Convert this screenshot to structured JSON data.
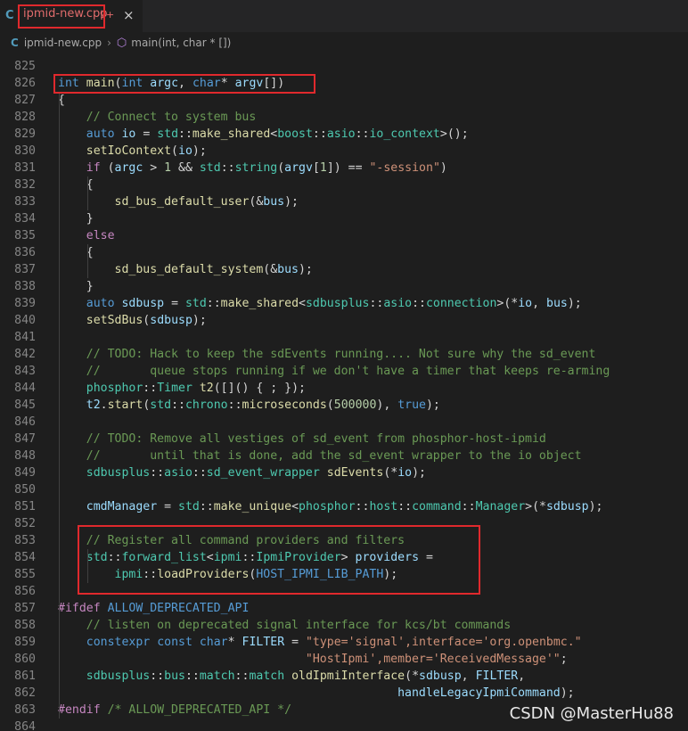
{
  "tab": {
    "icon": "C",
    "filename": "ipmid-new.cpp",
    "badge": "9+",
    "close": "×"
  },
  "breadcrumb": {
    "file": "ipmid-new.cpp",
    "separator": "›",
    "symbol": "main(int, char * [])"
  },
  "watermark": "CSDN @MasterHu88",
  "accent_colors": {
    "highlight_box": "#e0292d",
    "keyword": "#569cd6",
    "type": "#4ec9b0",
    "function": "#dcdcaa",
    "string": "#ce9178",
    "comment": "#6a9955"
  },
  "code": [
    {
      "n": "825",
      "t": []
    },
    {
      "n": "826",
      "t": [
        [
          "kw",
          "int"
        ],
        [
          "pun",
          " "
        ],
        [
          "fn",
          "main"
        ],
        [
          "pun",
          "("
        ],
        [
          "kw",
          "int"
        ],
        [
          "pun",
          " "
        ],
        [
          "var",
          "argc"
        ],
        [
          "pun",
          ", "
        ],
        [
          "kw",
          "char"
        ],
        [
          "pun",
          "* "
        ],
        [
          "var",
          "argv"
        ],
        [
          "pun",
          "[])"
        ]
      ]
    },
    {
      "n": "827",
      "t": [
        [
          "pun",
          "{"
        ]
      ]
    },
    {
      "n": "828",
      "t": [
        [
          "pun",
          "    "
        ],
        [
          "cm",
          "// Connect to system bus"
        ]
      ]
    },
    {
      "n": "829",
      "t": [
        [
          "pun",
          "    "
        ],
        [
          "kw",
          "auto"
        ],
        [
          "pun",
          " "
        ],
        [
          "var",
          "io"
        ],
        [
          "pun",
          " = "
        ],
        [
          "ty",
          "std"
        ],
        [
          "pun",
          "::"
        ],
        [
          "fn",
          "make_shared"
        ],
        [
          "pun",
          "<"
        ],
        [
          "ty",
          "boost"
        ],
        [
          "pun",
          "::"
        ],
        [
          "ty",
          "asio"
        ],
        [
          "pun",
          "::"
        ],
        [
          "ty",
          "io_context"
        ],
        [
          "pun",
          ">();"
        ]
      ]
    },
    {
      "n": "830",
      "t": [
        [
          "pun",
          "    "
        ],
        [
          "fn",
          "setIoContext"
        ],
        [
          "pun",
          "("
        ],
        [
          "var",
          "io"
        ],
        [
          "pun",
          ");"
        ]
      ]
    },
    {
      "n": "831",
      "t": [
        [
          "pun",
          "    "
        ],
        [
          "ctl",
          "if"
        ],
        [
          "pun",
          " ("
        ],
        [
          "var",
          "argc"
        ],
        [
          "pun",
          " > "
        ],
        [
          "num",
          "1"
        ],
        [
          "pun",
          " && "
        ],
        [
          "ty",
          "std"
        ],
        [
          "pun",
          "::"
        ],
        [
          "ty",
          "string"
        ],
        [
          "pun",
          "("
        ],
        [
          "var",
          "argv"
        ],
        [
          "pun",
          "["
        ],
        [
          "num",
          "1"
        ],
        [
          "pun",
          "]) == "
        ],
        [
          "str",
          "\"-session\""
        ],
        [
          "pun",
          ")"
        ]
      ]
    },
    {
      "n": "832",
      "t": [
        [
          "pun",
          "    {"
        ]
      ]
    },
    {
      "n": "833",
      "t": [
        [
          "pun",
          "        "
        ],
        [
          "fn",
          "sd_bus_default_user"
        ],
        [
          "pun",
          "(&"
        ],
        [
          "var",
          "bus"
        ],
        [
          "pun",
          ");"
        ]
      ]
    },
    {
      "n": "834",
      "t": [
        [
          "pun",
          "    }"
        ]
      ]
    },
    {
      "n": "835",
      "t": [
        [
          "pun",
          "    "
        ],
        [
          "ctl",
          "else"
        ]
      ]
    },
    {
      "n": "836",
      "t": [
        [
          "pun",
          "    {"
        ]
      ]
    },
    {
      "n": "837",
      "t": [
        [
          "pun",
          "        "
        ],
        [
          "fn",
          "sd_bus_default_system"
        ],
        [
          "pun",
          "(&"
        ],
        [
          "var",
          "bus"
        ],
        [
          "pun",
          ");"
        ]
      ]
    },
    {
      "n": "838",
      "t": [
        [
          "pun",
          "    }"
        ]
      ]
    },
    {
      "n": "839",
      "t": [
        [
          "pun",
          "    "
        ],
        [
          "kw",
          "auto"
        ],
        [
          "pun",
          " "
        ],
        [
          "var",
          "sdbusp"
        ],
        [
          "pun",
          " = "
        ],
        [
          "ty",
          "std"
        ],
        [
          "pun",
          "::"
        ],
        [
          "fn",
          "make_shared"
        ],
        [
          "pun",
          "<"
        ],
        [
          "ty",
          "sdbusplus"
        ],
        [
          "pun",
          "::"
        ],
        [
          "ty",
          "asio"
        ],
        [
          "pun",
          "::"
        ],
        [
          "ty",
          "connection"
        ],
        [
          "pun",
          ">(*"
        ],
        [
          "var",
          "io"
        ],
        [
          "pun",
          ", "
        ],
        [
          "var",
          "bus"
        ],
        [
          "pun",
          ");"
        ]
      ]
    },
    {
      "n": "840",
      "t": [
        [
          "pun",
          "    "
        ],
        [
          "fn",
          "setSdBus"
        ],
        [
          "pun",
          "("
        ],
        [
          "var",
          "sdbusp"
        ],
        [
          "pun",
          ");"
        ]
      ]
    },
    {
      "n": "841",
      "t": []
    },
    {
      "n": "842",
      "t": [
        [
          "pun",
          "    "
        ],
        [
          "cm",
          "// TODO: Hack to keep the sdEvents running.... Not sure why the sd_event"
        ]
      ]
    },
    {
      "n": "843",
      "t": [
        [
          "pun",
          "    "
        ],
        [
          "cm",
          "//       queue stops running if we don't have a timer that keeps re-arming"
        ]
      ]
    },
    {
      "n": "844",
      "t": [
        [
          "pun",
          "    "
        ],
        [
          "ty",
          "phosphor"
        ],
        [
          "pun",
          "::"
        ],
        [
          "ty",
          "Timer"
        ],
        [
          "pun",
          " "
        ],
        [
          "fn",
          "t2"
        ],
        [
          "pun",
          "([]() { ; });"
        ]
      ]
    },
    {
      "n": "845",
      "t": [
        [
          "pun",
          "    "
        ],
        [
          "var",
          "t2"
        ],
        [
          "pun",
          "."
        ],
        [
          "fn",
          "start"
        ],
        [
          "pun",
          "("
        ],
        [
          "ty",
          "std"
        ],
        [
          "pun",
          "::"
        ],
        [
          "ty",
          "chrono"
        ],
        [
          "pun",
          "::"
        ],
        [
          "fn",
          "microseconds"
        ],
        [
          "pun",
          "("
        ],
        [
          "num",
          "500000"
        ],
        [
          "pun",
          "), "
        ],
        [
          "kw",
          "true"
        ],
        [
          "pun",
          ");"
        ]
      ]
    },
    {
      "n": "846",
      "t": []
    },
    {
      "n": "847",
      "t": [
        [
          "pun",
          "    "
        ],
        [
          "cm",
          "// TODO: Remove all vestiges of sd_event from phosphor-host-ipmid"
        ]
      ]
    },
    {
      "n": "848",
      "t": [
        [
          "pun",
          "    "
        ],
        [
          "cm",
          "//       until that is done, add the sd_event wrapper to the io object"
        ]
      ]
    },
    {
      "n": "849",
      "t": [
        [
          "pun",
          "    "
        ],
        [
          "ty",
          "sdbusplus"
        ],
        [
          "pun",
          "::"
        ],
        [
          "ty",
          "asio"
        ],
        [
          "pun",
          "::"
        ],
        [
          "ty",
          "sd_event_wrapper"
        ],
        [
          "pun",
          " "
        ],
        [
          "fn",
          "sdEvents"
        ],
        [
          "pun",
          "(*"
        ],
        [
          "var",
          "io"
        ],
        [
          "pun",
          ");"
        ]
      ]
    },
    {
      "n": "850",
      "t": []
    },
    {
      "n": "851",
      "t": [
        [
          "pun",
          "    "
        ],
        [
          "var",
          "cmdManager"
        ],
        [
          "pun",
          " = "
        ],
        [
          "ty",
          "std"
        ],
        [
          "pun",
          "::"
        ],
        [
          "fn",
          "make_unique"
        ],
        [
          "pun",
          "<"
        ],
        [
          "ty",
          "phosphor"
        ],
        [
          "pun",
          "::"
        ],
        [
          "ty",
          "host"
        ],
        [
          "pun",
          "::"
        ],
        [
          "ty",
          "command"
        ],
        [
          "pun",
          "::"
        ],
        [
          "ty",
          "Manager"
        ],
        [
          "pun",
          ">(*"
        ],
        [
          "var",
          "sdbusp"
        ],
        [
          "pun",
          ");"
        ]
      ]
    },
    {
      "n": "852",
      "t": []
    },
    {
      "n": "853",
      "t": [
        [
          "pun",
          "    "
        ],
        [
          "cm",
          "// Register all command providers and filters"
        ]
      ]
    },
    {
      "n": "854",
      "t": [
        [
          "pun",
          "    "
        ],
        [
          "ty",
          "std"
        ],
        [
          "pun",
          "::"
        ],
        [
          "ty",
          "forward_list"
        ],
        [
          "pun",
          "<"
        ],
        [
          "ty",
          "ipmi"
        ],
        [
          "pun",
          "::"
        ],
        [
          "ty",
          "IpmiProvider"
        ],
        [
          "pun",
          "> "
        ],
        [
          "var",
          "providers"
        ],
        [
          "pun",
          " ="
        ]
      ]
    },
    {
      "n": "855",
      "t": [
        [
          "pun",
          "        "
        ],
        [
          "ty",
          "ipmi"
        ],
        [
          "pun",
          "::"
        ],
        [
          "fn",
          "loadProviders"
        ],
        [
          "pun",
          "("
        ],
        [
          "mac",
          "HOST_IPMI_LIB_PATH"
        ],
        [
          "pun",
          ");"
        ]
      ]
    },
    {
      "n": "856",
      "t": []
    },
    {
      "n": "857",
      "t": [
        [
          "ctl",
          "#ifdef"
        ],
        [
          "pun",
          " "
        ],
        [
          "mac",
          "ALLOW_DEPRECATED_API"
        ]
      ]
    },
    {
      "n": "858",
      "t": [
        [
          "pun",
          "    "
        ],
        [
          "cm",
          "// listen on deprecated signal interface for kcs/bt commands"
        ]
      ]
    },
    {
      "n": "859",
      "t": [
        [
          "pun",
          "    "
        ],
        [
          "kw",
          "constexpr"
        ],
        [
          "pun",
          " "
        ],
        [
          "kw",
          "const"
        ],
        [
          "pun",
          " "
        ],
        [
          "kw",
          "char"
        ],
        [
          "pun",
          "* "
        ],
        [
          "var",
          "FILTER"
        ],
        [
          "pun",
          " = "
        ],
        [
          "str",
          "\"type='signal',interface='org.openbmc.\""
        ]
      ]
    },
    {
      "n": "860",
      "t": [
        [
          "pun",
          "                                   "
        ],
        [
          "str",
          "\"HostIpmi',member='ReceivedMessage'\""
        ],
        [
          "pun",
          ";"
        ]
      ]
    },
    {
      "n": "861",
      "t": [
        [
          "pun",
          "    "
        ],
        [
          "ty",
          "sdbusplus"
        ],
        [
          "pun",
          "::"
        ],
        [
          "ty",
          "bus"
        ],
        [
          "pun",
          "::"
        ],
        [
          "ty",
          "match"
        ],
        [
          "pun",
          "::"
        ],
        [
          "ty",
          "match"
        ],
        [
          "pun",
          " "
        ],
        [
          "fn",
          "oldIpmiInterface"
        ],
        [
          "pun",
          "(*"
        ],
        [
          "var",
          "sdbusp"
        ],
        [
          "pun",
          ", "
        ],
        [
          "var",
          "FILTER"
        ],
        [
          "pun",
          ","
        ]
      ]
    },
    {
      "n": "862",
      "t": [
        [
          "pun",
          "                                                "
        ],
        [
          "var",
          "handleLegacyIpmiCommand"
        ],
        [
          "pun",
          ");"
        ]
      ]
    },
    {
      "n": "863",
      "t": [
        [
          "ctl",
          "#endif"
        ],
        [
          "pun",
          " "
        ],
        [
          "cm",
          "/* ALLOW_DEPRECATED_API */"
        ]
      ]
    },
    {
      "n": "864",
      "t": []
    }
  ]
}
